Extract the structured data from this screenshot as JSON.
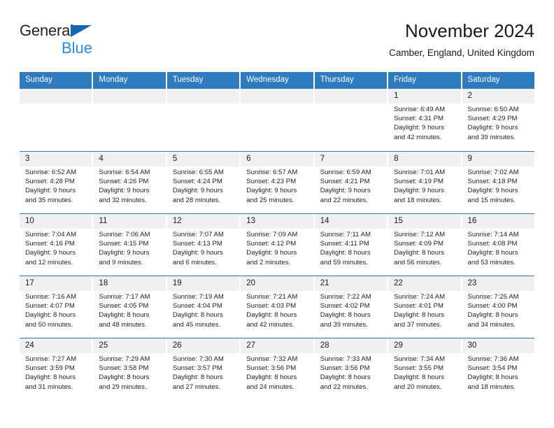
{
  "brand": {
    "line1": "General",
    "line2": "Blue",
    "triangle_color": "#1667b2",
    "blue_text_color": "#2e8bd8"
  },
  "header": {
    "title": "November 2024",
    "subtitle": "Camber, England, United Kingdom"
  },
  "theme": {
    "header_blue": "#2f7bc0",
    "daynum_band": "#f0f0f0",
    "text": "#222222"
  },
  "calendar": {
    "weekdays": [
      "Sunday",
      "Monday",
      "Tuesday",
      "Wednesday",
      "Thursday",
      "Friday",
      "Saturday"
    ],
    "weeks": [
      [
        {
          "day": "",
          "empty": true,
          "sunrise": "",
          "sunset": "",
          "daylight1": "",
          "daylight2": ""
        },
        {
          "day": "",
          "empty": true,
          "sunrise": "",
          "sunset": "",
          "daylight1": "",
          "daylight2": ""
        },
        {
          "day": "",
          "empty": true,
          "sunrise": "",
          "sunset": "",
          "daylight1": "",
          "daylight2": ""
        },
        {
          "day": "",
          "empty": true,
          "sunrise": "",
          "sunset": "",
          "daylight1": "",
          "daylight2": ""
        },
        {
          "day": "",
          "empty": true,
          "sunrise": "",
          "sunset": "",
          "daylight1": "",
          "daylight2": ""
        },
        {
          "day": "1",
          "empty": false,
          "sunrise": "Sunrise: 6:49 AM",
          "sunset": "Sunset: 4:31 PM",
          "daylight1": "Daylight: 9 hours",
          "daylight2": "and 42 minutes."
        },
        {
          "day": "2",
          "empty": false,
          "sunrise": "Sunrise: 6:50 AM",
          "sunset": "Sunset: 4:29 PM",
          "daylight1": "Daylight: 9 hours",
          "daylight2": "and 39 minutes."
        }
      ],
      [
        {
          "day": "3",
          "empty": false,
          "sunrise": "Sunrise: 6:52 AM",
          "sunset": "Sunset: 4:28 PM",
          "daylight1": "Daylight: 9 hours",
          "daylight2": "and 35 minutes."
        },
        {
          "day": "4",
          "empty": false,
          "sunrise": "Sunrise: 6:54 AM",
          "sunset": "Sunset: 4:26 PM",
          "daylight1": "Daylight: 9 hours",
          "daylight2": "and 32 minutes."
        },
        {
          "day": "5",
          "empty": false,
          "sunrise": "Sunrise: 6:55 AM",
          "sunset": "Sunset: 4:24 PM",
          "daylight1": "Daylight: 9 hours",
          "daylight2": "and 28 minutes."
        },
        {
          "day": "6",
          "empty": false,
          "sunrise": "Sunrise: 6:57 AM",
          "sunset": "Sunset: 4:23 PM",
          "daylight1": "Daylight: 9 hours",
          "daylight2": "and 25 minutes."
        },
        {
          "day": "7",
          "empty": false,
          "sunrise": "Sunrise: 6:59 AM",
          "sunset": "Sunset: 4:21 PM",
          "daylight1": "Daylight: 9 hours",
          "daylight2": "and 22 minutes."
        },
        {
          "day": "8",
          "empty": false,
          "sunrise": "Sunrise: 7:01 AM",
          "sunset": "Sunset: 4:19 PM",
          "daylight1": "Daylight: 9 hours",
          "daylight2": "and 18 minutes."
        },
        {
          "day": "9",
          "empty": false,
          "sunrise": "Sunrise: 7:02 AM",
          "sunset": "Sunset: 4:18 PM",
          "daylight1": "Daylight: 9 hours",
          "daylight2": "and 15 minutes."
        }
      ],
      [
        {
          "day": "10",
          "empty": false,
          "sunrise": "Sunrise: 7:04 AM",
          "sunset": "Sunset: 4:16 PM",
          "daylight1": "Daylight: 9 hours",
          "daylight2": "and 12 minutes."
        },
        {
          "day": "11",
          "empty": false,
          "sunrise": "Sunrise: 7:06 AM",
          "sunset": "Sunset: 4:15 PM",
          "daylight1": "Daylight: 9 hours",
          "daylight2": "and 9 minutes."
        },
        {
          "day": "12",
          "empty": false,
          "sunrise": "Sunrise: 7:07 AM",
          "sunset": "Sunset: 4:13 PM",
          "daylight1": "Daylight: 9 hours",
          "daylight2": "and 6 minutes."
        },
        {
          "day": "13",
          "empty": false,
          "sunrise": "Sunrise: 7:09 AM",
          "sunset": "Sunset: 4:12 PM",
          "daylight1": "Daylight: 9 hours",
          "daylight2": "and 2 minutes."
        },
        {
          "day": "14",
          "empty": false,
          "sunrise": "Sunrise: 7:11 AM",
          "sunset": "Sunset: 4:11 PM",
          "daylight1": "Daylight: 8 hours",
          "daylight2": "and 59 minutes."
        },
        {
          "day": "15",
          "empty": false,
          "sunrise": "Sunrise: 7:12 AM",
          "sunset": "Sunset: 4:09 PM",
          "daylight1": "Daylight: 8 hours",
          "daylight2": "and 56 minutes."
        },
        {
          "day": "16",
          "empty": false,
          "sunrise": "Sunrise: 7:14 AM",
          "sunset": "Sunset: 4:08 PM",
          "daylight1": "Daylight: 8 hours",
          "daylight2": "and 53 minutes."
        }
      ],
      [
        {
          "day": "17",
          "empty": false,
          "sunrise": "Sunrise: 7:16 AM",
          "sunset": "Sunset: 4:07 PM",
          "daylight1": "Daylight: 8 hours",
          "daylight2": "and 50 minutes."
        },
        {
          "day": "18",
          "empty": false,
          "sunrise": "Sunrise: 7:17 AM",
          "sunset": "Sunset: 4:05 PM",
          "daylight1": "Daylight: 8 hours",
          "daylight2": "and 48 minutes."
        },
        {
          "day": "19",
          "empty": false,
          "sunrise": "Sunrise: 7:19 AM",
          "sunset": "Sunset: 4:04 PM",
          "daylight1": "Daylight: 8 hours",
          "daylight2": "and 45 minutes."
        },
        {
          "day": "20",
          "empty": false,
          "sunrise": "Sunrise: 7:21 AM",
          "sunset": "Sunset: 4:03 PM",
          "daylight1": "Daylight: 8 hours",
          "daylight2": "and 42 minutes."
        },
        {
          "day": "21",
          "empty": false,
          "sunrise": "Sunrise: 7:22 AM",
          "sunset": "Sunset: 4:02 PM",
          "daylight1": "Daylight: 8 hours",
          "daylight2": "and 39 minutes."
        },
        {
          "day": "22",
          "empty": false,
          "sunrise": "Sunrise: 7:24 AM",
          "sunset": "Sunset: 4:01 PM",
          "daylight1": "Daylight: 8 hours",
          "daylight2": "and 37 minutes."
        },
        {
          "day": "23",
          "empty": false,
          "sunrise": "Sunrise: 7:25 AM",
          "sunset": "Sunset: 4:00 PM",
          "daylight1": "Daylight: 8 hours",
          "daylight2": "and 34 minutes."
        }
      ],
      [
        {
          "day": "24",
          "empty": false,
          "sunrise": "Sunrise: 7:27 AM",
          "sunset": "Sunset: 3:59 PM",
          "daylight1": "Daylight: 8 hours",
          "daylight2": "and 31 minutes."
        },
        {
          "day": "25",
          "empty": false,
          "sunrise": "Sunrise: 7:29 AM",
          "sunset": "Sunset: 3:58 PM",
          "daylight1": "Daylight: 8 hours",
          "daylight2": "and 29 minutes."
        },
        {
          "day": "26",
          "empty": false,
          "sunrise": "Sunrise: 7:30 AM",
          "sunset": "Sunset: 3:57 PM",
          "daylight1": "Daylight: 8 hours",
          "daylight2": "and 27 minutes."
        },
        {
          "day": "27",
          "empty": false,
          "sunrise": "Sunrise: 7:32 AM",
          "sunset": "Sunset: 3:56 PM",
          "daylight1": "Daylight: 8 hours",
          "daylight2": "and 24 minutes."
        },
        {
          "day": "28",
          "empty": false,
          "sunrise": "Sunrise: 7:33 AM",
          "sunset": "Sunset: 3:56 PM",
          "daylight1": "Daylight: 8 hours",
          "daylight2": "and 22 minutes."
        },
        {
          "day": "29",
          "empty": false,
          "sunrise": "Sunrise: 7:34 AM",
          "sunset": "Sunset: 3:55 PM",
          "daylight1": "Daylight: 8 hours",
          "daylight2": "and 20 minutes."
        },
        {
          "day": "30",
          "empty": false,
          "sunrise": "Sunrise: 7:36 AM",
          "sunset": "Sunset: 3:54 PM",
          "daylight1": "Daylight: 8 hours",
          "daylight2": "and 18 minutes."
        }
      ]
    ]
  }
}
